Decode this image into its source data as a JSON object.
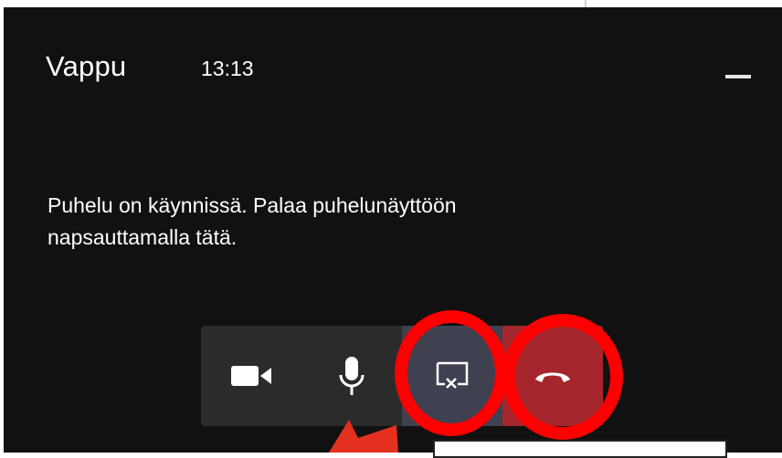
{
  "window": {
    "title": "Vappu",
    "time": "13:13",
    "minimize_label": "minimize"
  },
  "message": {
    "line1": "Puhelu on käynnissä. Palaa puhelunäyttöön",
    "line2": "napsauttamalla tätä."
  },
  "controls": [
    {
      "name": "video",
      "icon": "video-camera-icon"
    },
    {
      "name": "microphone",
      "icon": "microphone-icon"
    },
    {
      "name": "stop-sharing",
      "icon": "stop-share-icon"
    },
    {
      "name": "hang-up",
      "icon": "phone-hangup-icon"
    }
  ],
  "colors": {
    "background": "#111111",
    "control_bar": "#2b2b2b",
    "share_active": "#3f4050",
    "hangup": "#a4262c",
    "annotation": "#ff0000"
  }
}
